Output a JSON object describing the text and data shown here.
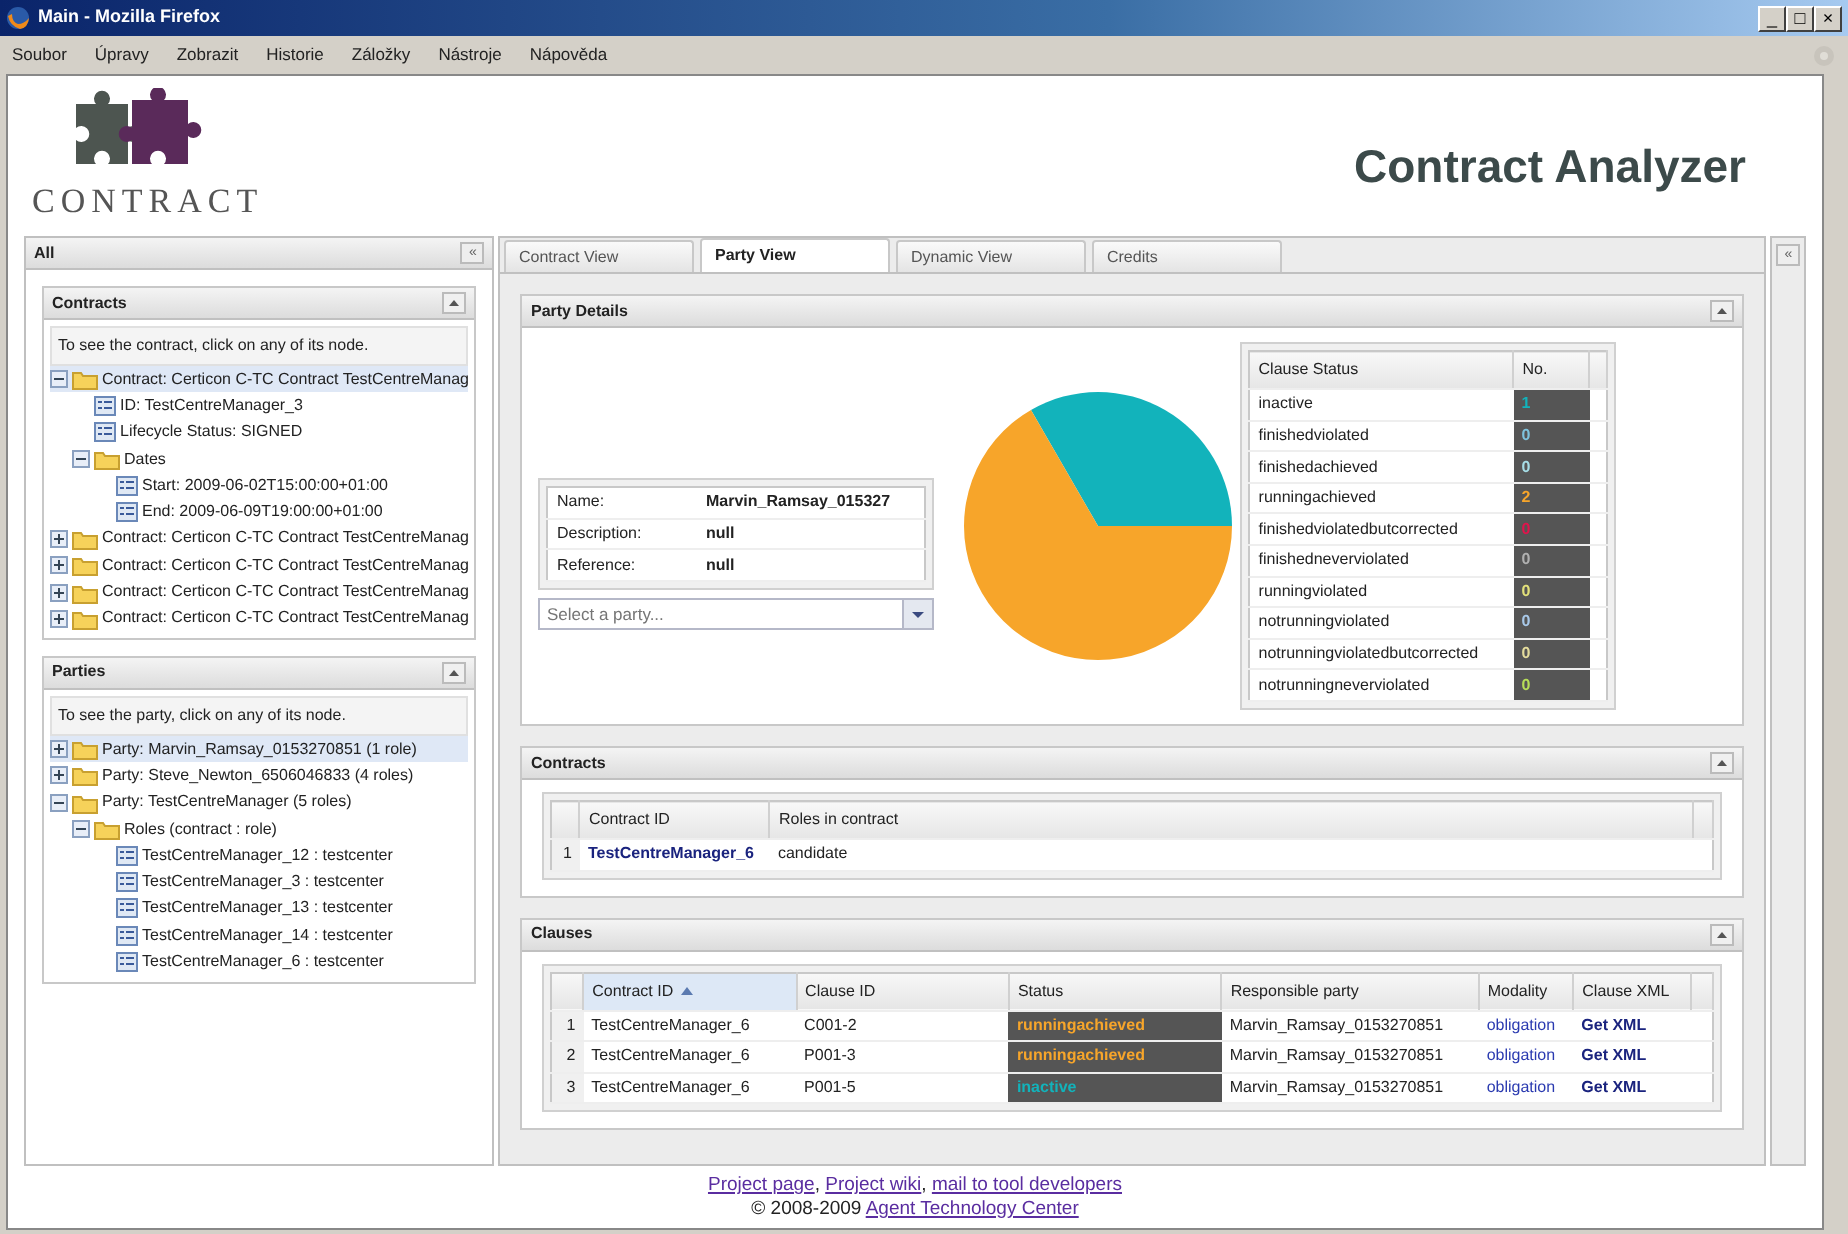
{
  "window": {
    "title": "Main - Mozilla Firefox",
    "controls": [
      "_",
      "□",
      "×"
    ]
  },
  "menu": [
    "Soubor",
    "Úpravy",
    "Zobrazit",
    "Historie",
    "Záložky",
    "Nástroje",
    "Nápověda"
  ],
  "logo": {
    "text": "CONTRACT"
  },
  "header_title": "Contract Analyzer",
  "left_panel": {
    "title": "All",
    "collapse": "«",
    "sections": [
      {
        "title": "Contracts",
        "hint": "To see the contract, click on any of its node.",
        "nodes": [
          {
            "label": "Contract: Certicon C-TC Contract TestCentreManag",
            "kind": "folder",
            "expanded": true,
            "selected": true,
            "children": [
              {
                "label": "ID: TestCentreManager_3",
                "kind": "leaf",
                "selected": false
              },
              {
                "label": "Lifecycle Status: SIGNED",
                "kind": "leaf",
                "selected": false
              },
              {
                "label": "Dates",
                "kind": "folder",
                "expanded": true,
                "selected": false,
                "children": [
                  {
                    "label": "Start: 2009-06-02T15:00:00+01:00",
                    "kind": "leaf",
                    "selected": false
                  },
                  {
                    "label": "End: 2009-06-09T19:00:00+01:00",
                    "kind": "leaf",
                    "selected": false
                  }
                ]
              }
            ]
          },
          {
            "label": "Contract: Certicon C-TC Contract TestCentreManag",
            "kind": "folder",
            "expanded": false,
            "selected": false
          },
          {
            "label": "Contract: Certicon C-TC Contract TestCentreManag",
            "kind": "folder",
            "expanded": false,
            "selected": false
          },
          {
            "label": "Contract: Certicon C-TC Contract TestCentreManag",
            "kind": "folder",
            "expanded": false,
            "selected": false
          },
          {
            "label": "Contract: Certicon C-TC Contract TestCentreManag",
            "kind": "folder",
            "expanded": false,
            "selected": false
          }
        ]
      },
      {
        "title": "Parties",
        "hint": "To see the party, click on any of its node.",
        "nodes": [
          {
            "label": "Party: Marvin_Ramsay_0153270851 (1 role)",
            "kind": "folder",
            "expanded": false,
            "selected": true
          },
          {
            "label": "Party: Steve_Newton_6506046833 (4 roles)",
            "kind": "folder",
            "expanded": false,
            "selected": false
          },
          {
            "label": "Party: TestCentreManager (5 roles)",
            "kind": "folder",
            "expanded": true,
            "selected": false,
            "children": [
              {
                "label": "Roles (contract : role)",
                "kind": "folder",
                "expanded": true,
                "selected": false,
                "children": [
                  {
                    "label": "TestCentreManager_12 : testcenter",
                    "kind": "leaf",
                    "selected": false
                  },
                  {
                    "label": "TestCentreManager_3 : testcenter",
                    "kind": "leaf",
                    "selected": false
                  },
                  {
                    "label": "TestCentreManager_13 : testcenter",
                    "kind": "leaf",
                    "selected": false
                  },
                  {
                    "label": "TestCentreManager_14 : testcenter",
                    "kind": "leaf",
                    "selected": false
                  },
                  {
                    "label": "TestCentreManager_6 : testcenter",
                    "kind": "leaf",
                    "selected": false
                  }
                ]
              }
            ]
          }
        ]
      }
    ]
  },
  "tabs": [
    {
      "label": "Contract View",
      "selected": false
    },
    {
      "label": "Party View",
      "selected": true
    },
    {
      "label": "Dynamic View",
      "selected": false
    },
    {
      "label": "Credits",
      "selected": false
    }
  ],
  "right_collapse": "«",
  "party_details": {
    "title": "Party Details",
    "fields": [
      {
        "label": "Name:",
        "value": "Marvin_Ramsay_015327"
      },
      {
        "label": "Description:",
        "value": "null"
      },
      {
        "label": "Reference:",
        "value": "null"
      }
    ],
    "select": {
      "placeholder": "Select a party..."
    },
    "clause_status": {
      "columns": [
        "Clause Status",
        "No."
      ],
      "rows": [
        {
          "status": "inactive",
          "count": "1",
          "color": "#12b3bb"
        },
        {
          "status": "finishedviolated",
          "count": "0",
          "color": "#7ec3dd"
        },
        {
          "status": "finishedachieved",
          "count": "0",
          "color": "#a6dde6"
        },
        {
          "status": "runningachieved",
          "count": "2",
          "color": "#f7a52a"
        },
        {
          "status": "finishedviolatedbutcorrected",
          "count": "0",
          "color": "#e0144c"
        },
        {
          "status": "finishedneverviolated",
          "count": "0",
          "color": "#b0b0b0"
        },
        {
          "status": "runningviolated",
          "count": "0",
          "color": "#e2e07a"
        },
        {
          "status": "notrunningviolated",
          "count": "0",
          "color": "#a8c8e8"
        },
        {
          "status": "notrunningviolatedbutcorrected",
          "count": "0",
          "color": "#e4dc9c"
        },
        {
          "status": "notrunningneverviolated",
          "count": "0",
          "color": "#b6de58"
        }
      ]
    }
  },
  "contracts": {
    "title": "Contracts",
    "columns": [
      "Contract ID",
      "Roles in contract"
    ],
    "rows": [
      {
        "index": "1",
        "contract_id": "TestCentreManager_6",
        "roles": "candidate"
      }
    ]
  },
  "clauses": {
    "title": "Clauses",
    "columns": [
      {
        "label": "Contract ID",
        "sorted": true
      },
      {
        "label": "Clause ID",
        "sorted": false
      },
      {
        "label": "Status",
        "sorted": false
      },
      {
        "label": "Responsible party",
        "sorted": false
      },
      {
        "label": "Modality",
        "sorted": false
      },
      {
        "label": "Clause XML",
        "sorted": false
      }
    ],
    "rows": [
      {
        "index": "1",
        "contract_id": "TestCentreManager_6",
        "clause_id": "C001-2",
        "status": "runningachieved",
        "color": "#f7a52a",
        "party": "Marvin_Ramsay_0153270851",
        "modality": "obligation",
        "xml": "Get XML"
      },
      {
        "index": "2",
        "contract_id": "TestCentreManager_6",
        "clause_id": "P001-3",
        "status": "runningachieved",
        "color": "#f7a52a",
        "party": "Marvin_Ramsay_0153270851",
        "modality": "obligation",
        "xml": "Get XML"
      },
      {
        "index": "3",
        "contract_id": "TestCentreManager_6",
        "clause_id": "P001-5",
        "status": "inactive",
        "color": "#12b3bb",
        "party": "Marvin_Ramsay_0153270851",
        "modality": "obligation",
        "xml": "Get XML"
      }
    ]
  },
  "footer": {
    "links": [
      "Project page",
      "Project wiki",
      "mail to tool developers"
    ],
    "separator": ",",
    "copyright": "© 2008-2009",
    "org_link": "Agent Technology Center"
  }
}
